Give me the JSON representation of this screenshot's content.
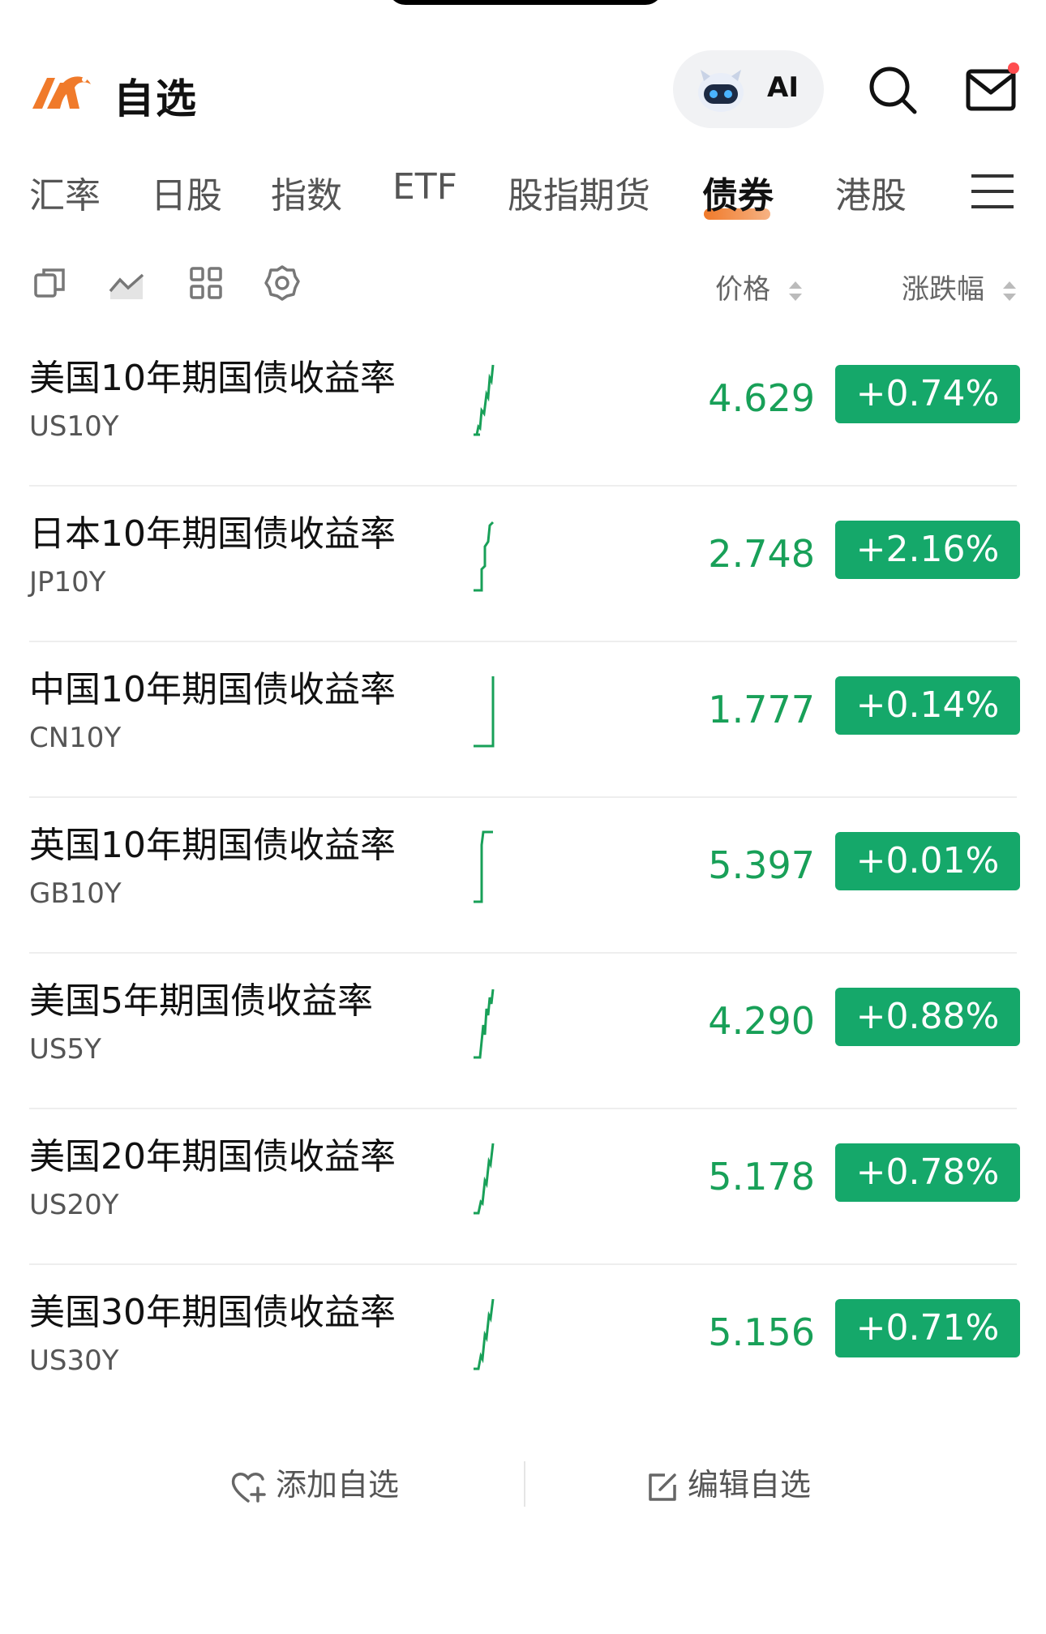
{
  "header": {
    "title": "自选",
    "ai_label": "AI",
    "accent": "#f07a2a",
    "notification_dot": "#ff4d4f"
  },
  "tabs": [
    {
      "label": "汇率",
      "active": false
    },
    {
      "label": "日股",
      "active": false
    },
    {
      "label": "指数",
      "active": false
    },
    {
      "label": "ETF",
      "active": false
    },
    {
      "label": "股指期货",
      "active": false
    },
    {
      "label": "债券",
      "active": true
    },
    {
      "label": "港股",
      "active": false
    }
  ],
  "toolbar": {
    "icons": [
      "copy-icon",
      "chart-icon",
      "grid-icon",
      "settings-icon"
    ],
    "price_header": "价格",
    "change_header": "涨跌幅"
  },
  "rows": [
    {
      "name": "美国10年期国债收益率",
      "code": "US10Y",
      "price": "4.629",
      "change": "+0.74%"
    },
    {
      "name": "日本10年期国债收益率",
      "code": "JP10Y",
      "price": "2.748",
      "change": "+2.16%"
    },
    {
      "name": "中国10年期国债收益率",
      "code": "CN10Y",
      "price": "1.777",
      "change": "+0.14%"
    },
    {
      "name": "英国10年期国债收益率",
      "code": "GB10Y",
      "price": "5.397",
      "change": "+0.01%"
    },
    {
      "name": "美国5年期国债收益率",
      "code": "US5Y",
      "price": "4.290",
      "change": "+0.88%"
    },
    {
      "name": "美国20年期国债收益率",
      "code": "US20Y",
      "price": "5.178",
      "change": "+0.78%"
    },
    {
      "name": "美国30年期国债收益率",
      "code": "US30Y",
      "price": "5.156",
      "change": "+0.71%"
    }
  ],
  "colors": {
    "up_green": "#15a86a",
    "price_green": "#18a058"
  },
  "bottom": {
    "add_label": "添加自选",
    "edit_label": "编辑自选"
  }
}
